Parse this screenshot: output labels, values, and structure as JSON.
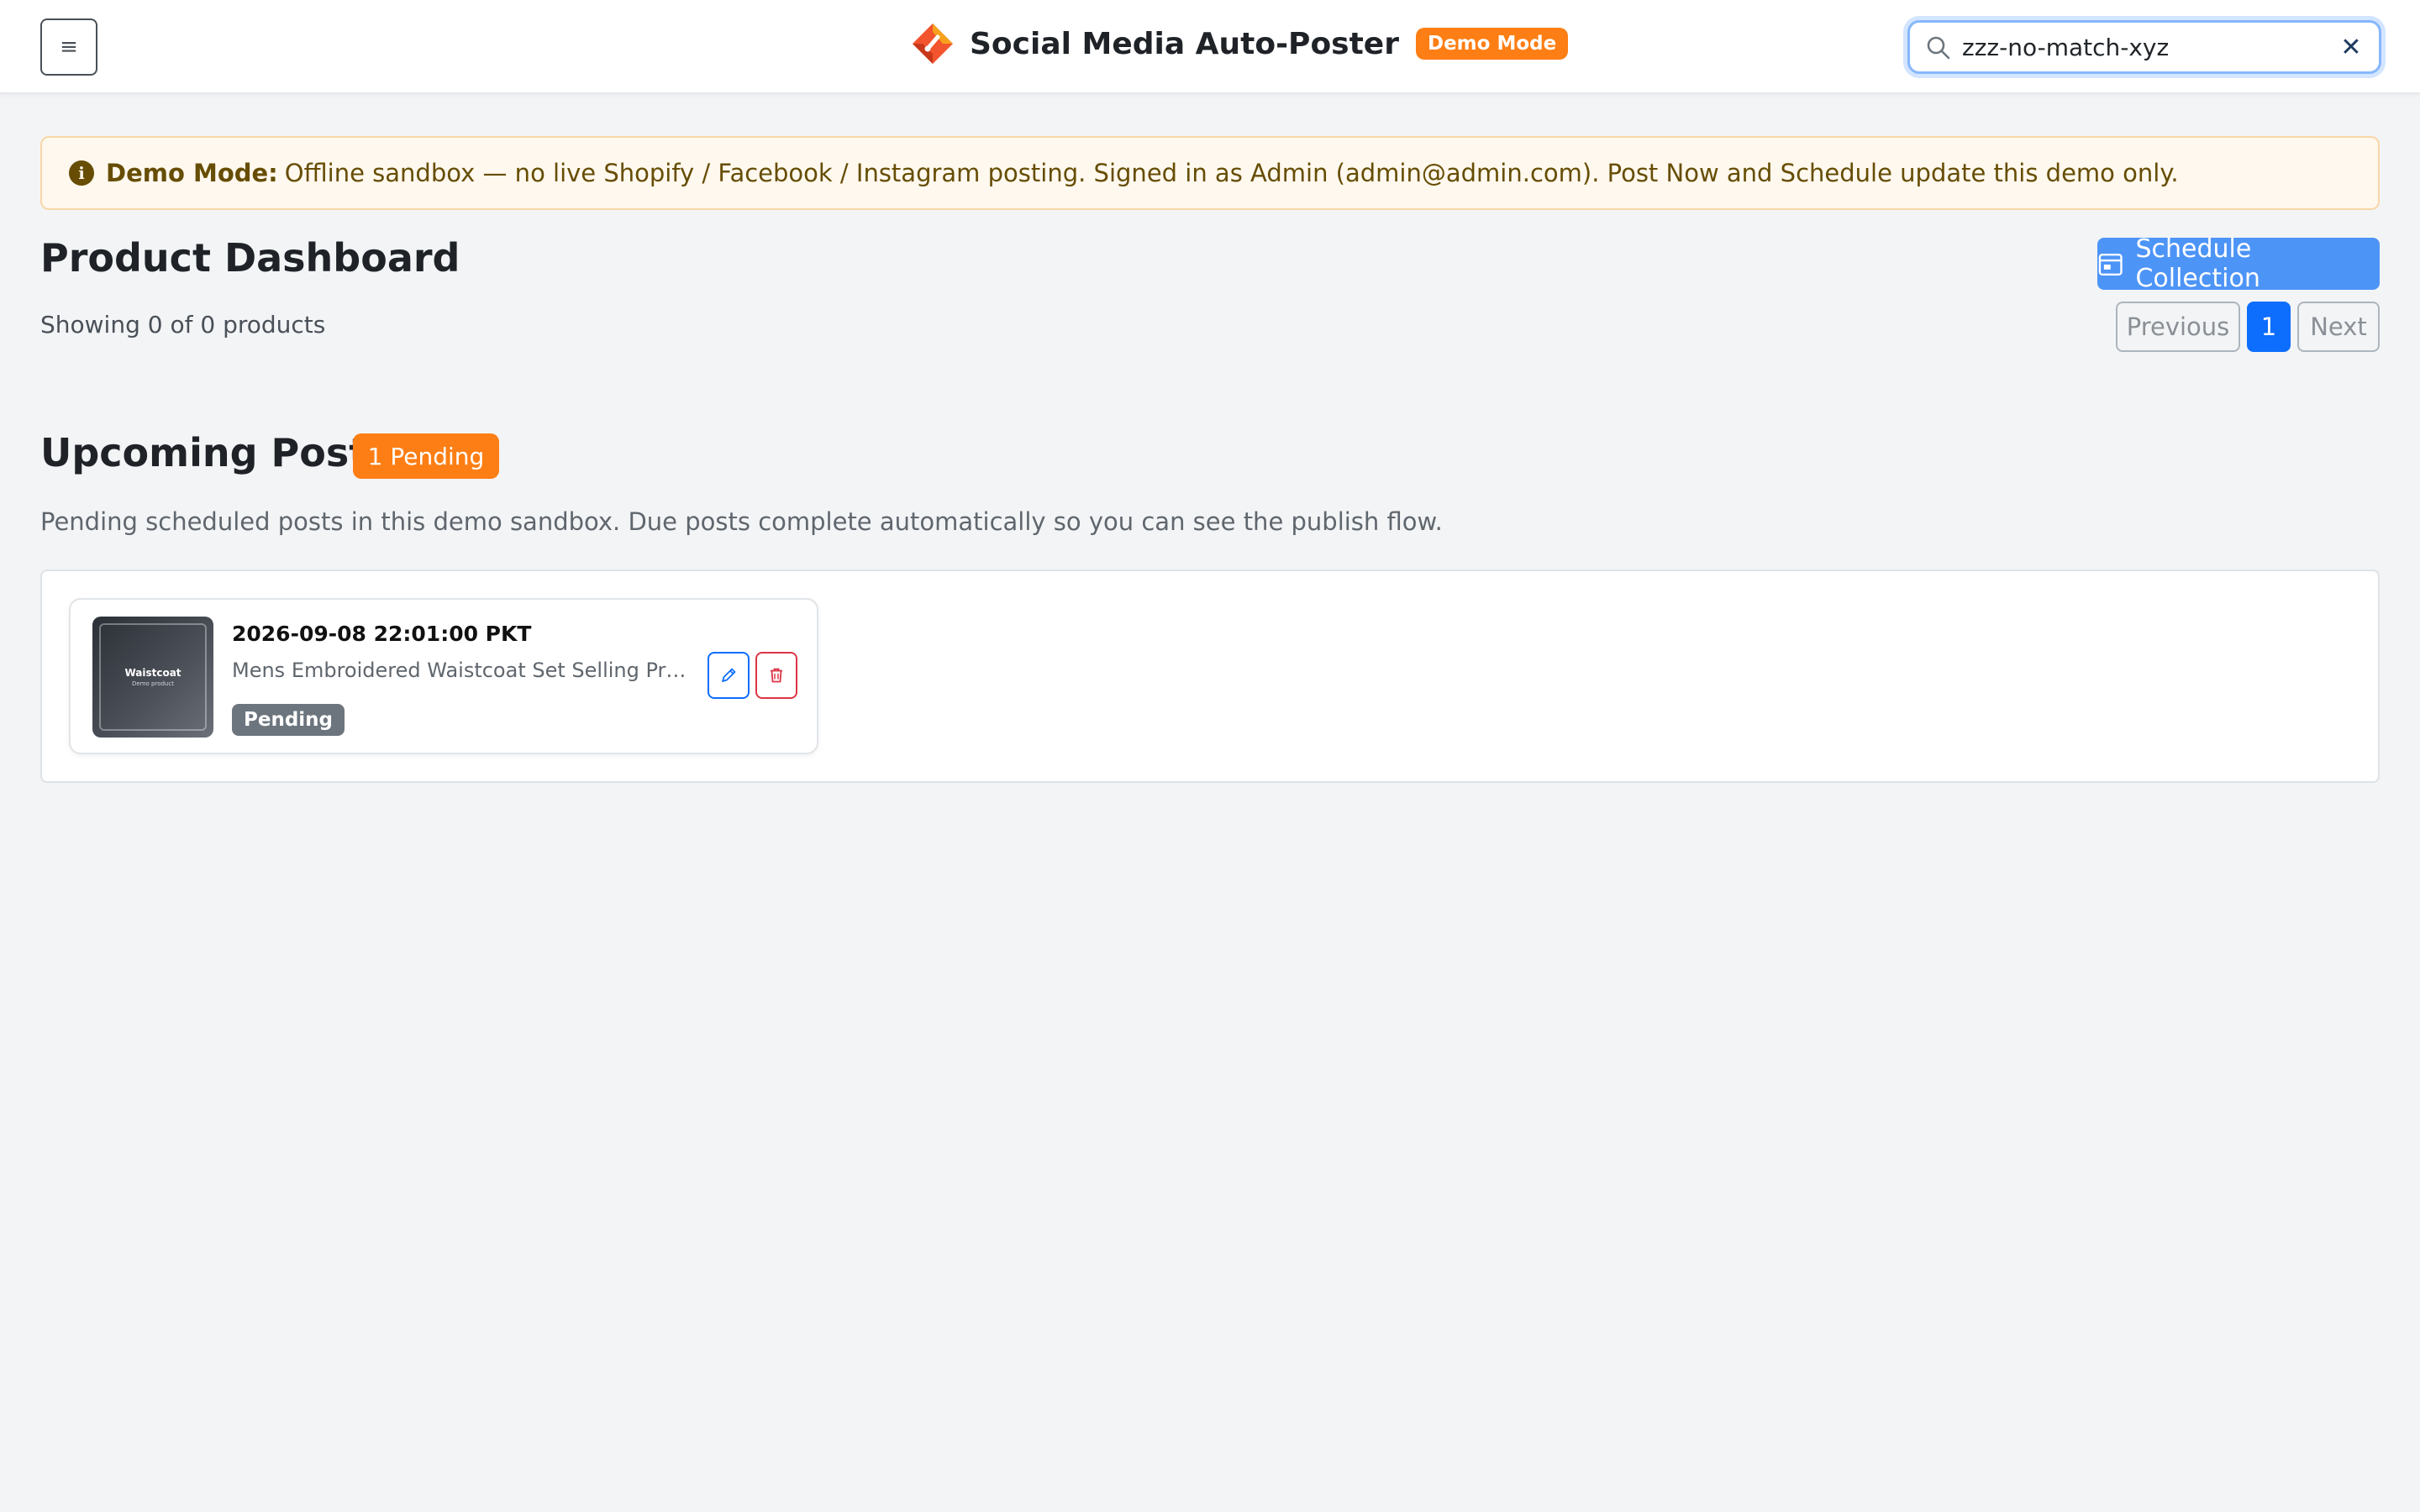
{
  "header": {
    "menu_glyph": "≡",
    "app_title": "Social Media Auto-Poster",
    "mode_badge": "Demo Mode",
    "search": {
      "value": "zzz-no-match-xyz",
      "clear_glyph": "✕"
    }
  },
  "alert": {
    "icon_glyph": "i",
    "label": "Demo Mode:",
    "message": "Offline sandbox — no live Shopify / Facebook / Instagram posting. Signed in as Admin (admin@admin.com). Post Now and Schedule update this demo only."
  },
  "dashboard": {
    "title": "Product Dashboard",
    "showing": "Showing 0 of 0 products",
    "schedule_button": "Schedule Collection",
    "pagination": {
      "previous": "Previous",
      "current": "1",
      "next": "Next"
    }
  },
  "upcoming": {
    "title": "Upcoming Posts",
    "pending_badge": "1 Pending",
    "description": "Pending scheduled posts in this demo sandbox. Due posts complete automatically so you can see the publish flow.",
    "posts": [
      {
        "thumb_title": "Waistcoat",
        "thumb_subtitle": "Demo product",
        "datetime": "2026-09-08 22:01:00 PKT",
        "text": "Mens Embroidered Waistcoat Set Selling Price:...",
        "status": "Pending"
      }
    ]
  },
  "colors": {
    "accent_orange": "#fd7e14",
    "primary_blue": "#0d6efd",
    "danger_red": "#dc3545",
    "alert_text": "#664d03",
    "page_bg": "#f3f4f6"
  },
  "icons": [
    "menu-icon",
    "logo-icon",
    "search-icon",
    "close-icon",
    "info-icon",
    "calendar-icon",
    "pencil-icon",
    "trash-icon"
  ]
}
